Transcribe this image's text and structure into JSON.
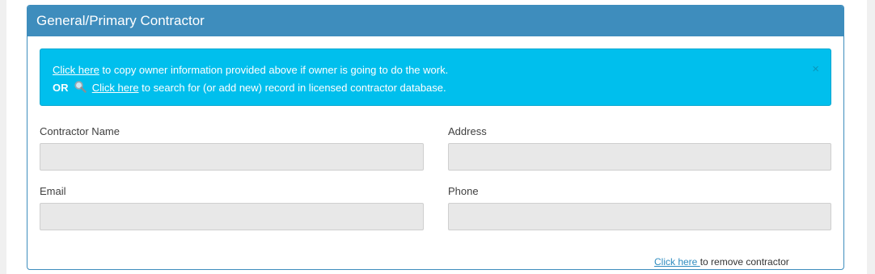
{
  "panel": {
    "title": "General/Primary Contractor"
  },
  "alert": {
    "line1": {
      "link_text": "Click here",
      "text": " to copy owner information provided above if owner is going to do the work."
    },
    "line2": {
      "or_text": "OR",
      "icon": "magnifying-glass-icon",
      "link_text": "Click here",
      "text": " to search for (or add new) record in licensed contractor database."
    },
    "close_label": "×"
  },
  "fields": {
    "contractor_name": {
      "label": "Contractor Name",
      "value": ""
    },
    "address": {
      "label": "Address",
      "value": ""
    },
    "email": {
      "label": "Email",
      "value": ""
    },
    "phone": {
      "label": "Phone",
      "value": ""
    }
  },
  "remove": {
    "link_text": "Click here ",
    "text": "to remove contractor"
  },
  "colors": {
    "panel_header": "#3e8dbd",
    "alert_bg": "#00bfed",
    "input_bg": "#e8e8e8",
    "link": "#2f8cc0"
  }
}
